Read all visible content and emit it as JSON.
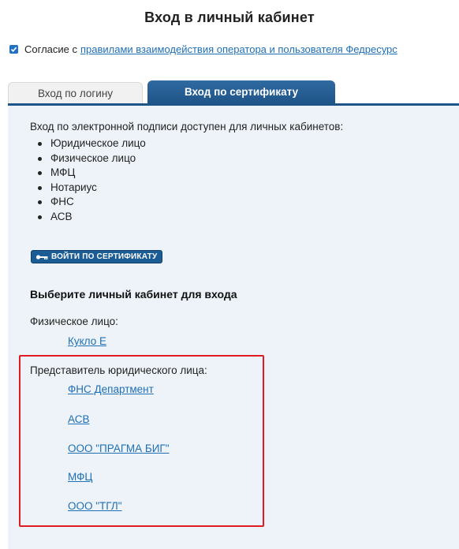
{
  "title": "Вход в личный кабинет",
  "consent": {
    "checked": true,
    "prefix": "Согласие с",
    "link_text": "правилами взаимодействия оператора и пользователя Федресурс"
  },
  "tabs": [
    {
      "label": "Вход по логину",
      "active": false
    },
    {
      "label": "Вход по сертификату",
      "active": true
    }
  ],
  "intro": "Вход по электронной подписи доступен для личных кабинетов:",
  "cabinet_types": [
    "Юридическое лицо",
    "Физическое лицо",
    "МФЦ",
    "Нотариус",
    "ФНС",
    "АСВ"
  ],
  "cert_button": {
    "label": "ВОЙТИ ПО СЕРТИФИКАТУ",
    "icon": "key-icon"
  },
  "choose_heading": "Выберите личный кабинет для входа",
  "individual": {
    "label": "Физическое лицо:",
    "accounts": [
      "Кукло Е"
    ]
  },
  "legal_rep": {
    "label": "Представитель юридического лица:",
    "accounts": [
      "ФНС Департмент",
      "АСВ",
      "ООО  \"ПРАГМА БИГ\"",
      "МФЦ",
      "ООО \"ТГЛ\""
    ]
  },
  "colors": {
    "accent": "#1f5488",
    "link": "#1f6fb5",
    "panel_bg": "#edf3f9",
    "highlight": "#e01b24"
  }
}
